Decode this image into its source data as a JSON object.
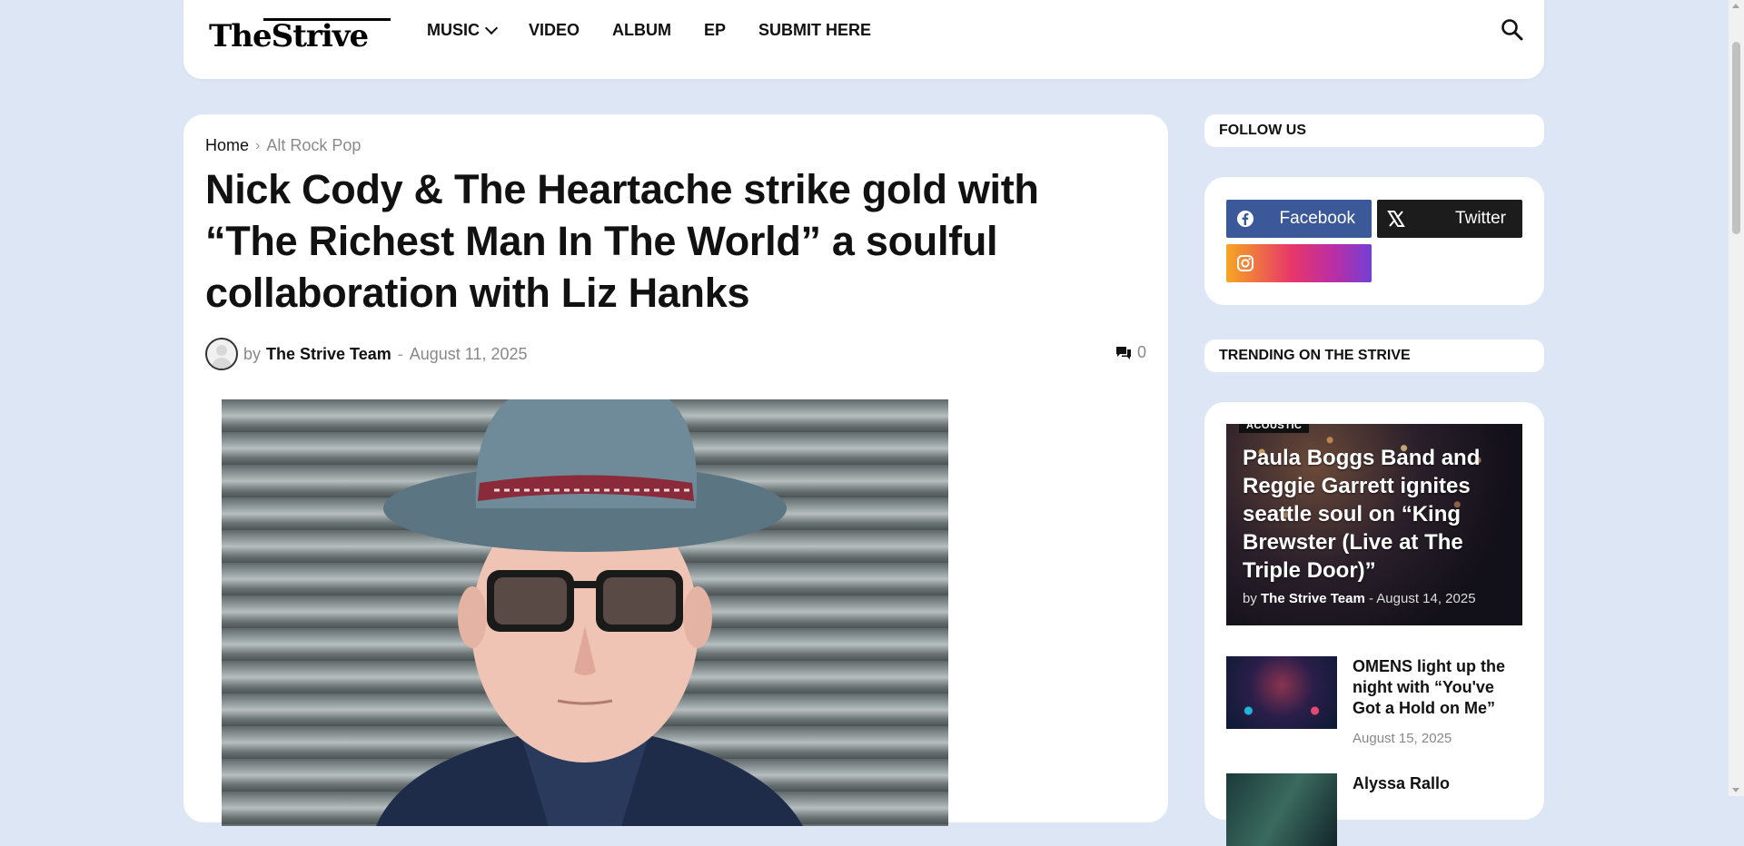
{
  "site": {
    "logo_text": "TheStrive"
  },
  "nav": {
    "items": [
      {
        "label": "MUSIC",
        "has_dropdown": true
      },
      {
        "label": "VIDEO"
      },
      {
        "label": "ALBUM"
      },
      {
        "label": "EP"
      },
      {
        "label": "SUBMIT HERE"
      }
    ],
    "search_icon": "search-icon"
  },
  "article": {
    "breadcrumb": {
      "home": "Home",
      "separator": "›",
      "category": "Alt Rock Pop"
    },
    "title": "Nick Cody & The Heartache strike gold with “The Richest Man In The World” a soulful collaboration with Liz Hanks",
    "meta": {
      "by": "by",
      "author": "The Strive Team",
      "separator": "-",
      "date": "August 11, 2025",
      "comments": "0"
    },
    "hero_image": "portrait-man-hat-sunglasses"
  },
  "sidebar": {
    "follow": {
      "heading": "FOLLOW US",
      "buttons": [
        {
          "label": "Facebook",
          "icon": "facebook-icon",
          "color": "#3b5998"
        },
        {
          "label": "Twitter",
          "icon": "x-icon",
          "color": "#1c1c1c"
        },
        {
          "label": "",
          "icon": "instagram-icon",
          "color": "#e8366a"
        }
      ]
    },
    "trending": {
      "heading": "TRENDING ON THE STRIVE",
      "featured": {
        "category": "ACOUSTIC",
        "title": "Paula Boggs Band and Reggie Garrett ignites seattle soul on “King Brewster (Live at The Triple Door)”",
        "by": "by",
        "author": "The Strive Team",
        "separator": "-",
        "date": "August 14, 2025"
      },
      "items": [
        {
          "title": "OMENS light up the night with “You've Got a Hold on Me”",
          "date": "August 15, 2025"
        },
        {
          "title": "Alyssa Rallo",
          "date": ""
        }
      ]
    }
  }
}
